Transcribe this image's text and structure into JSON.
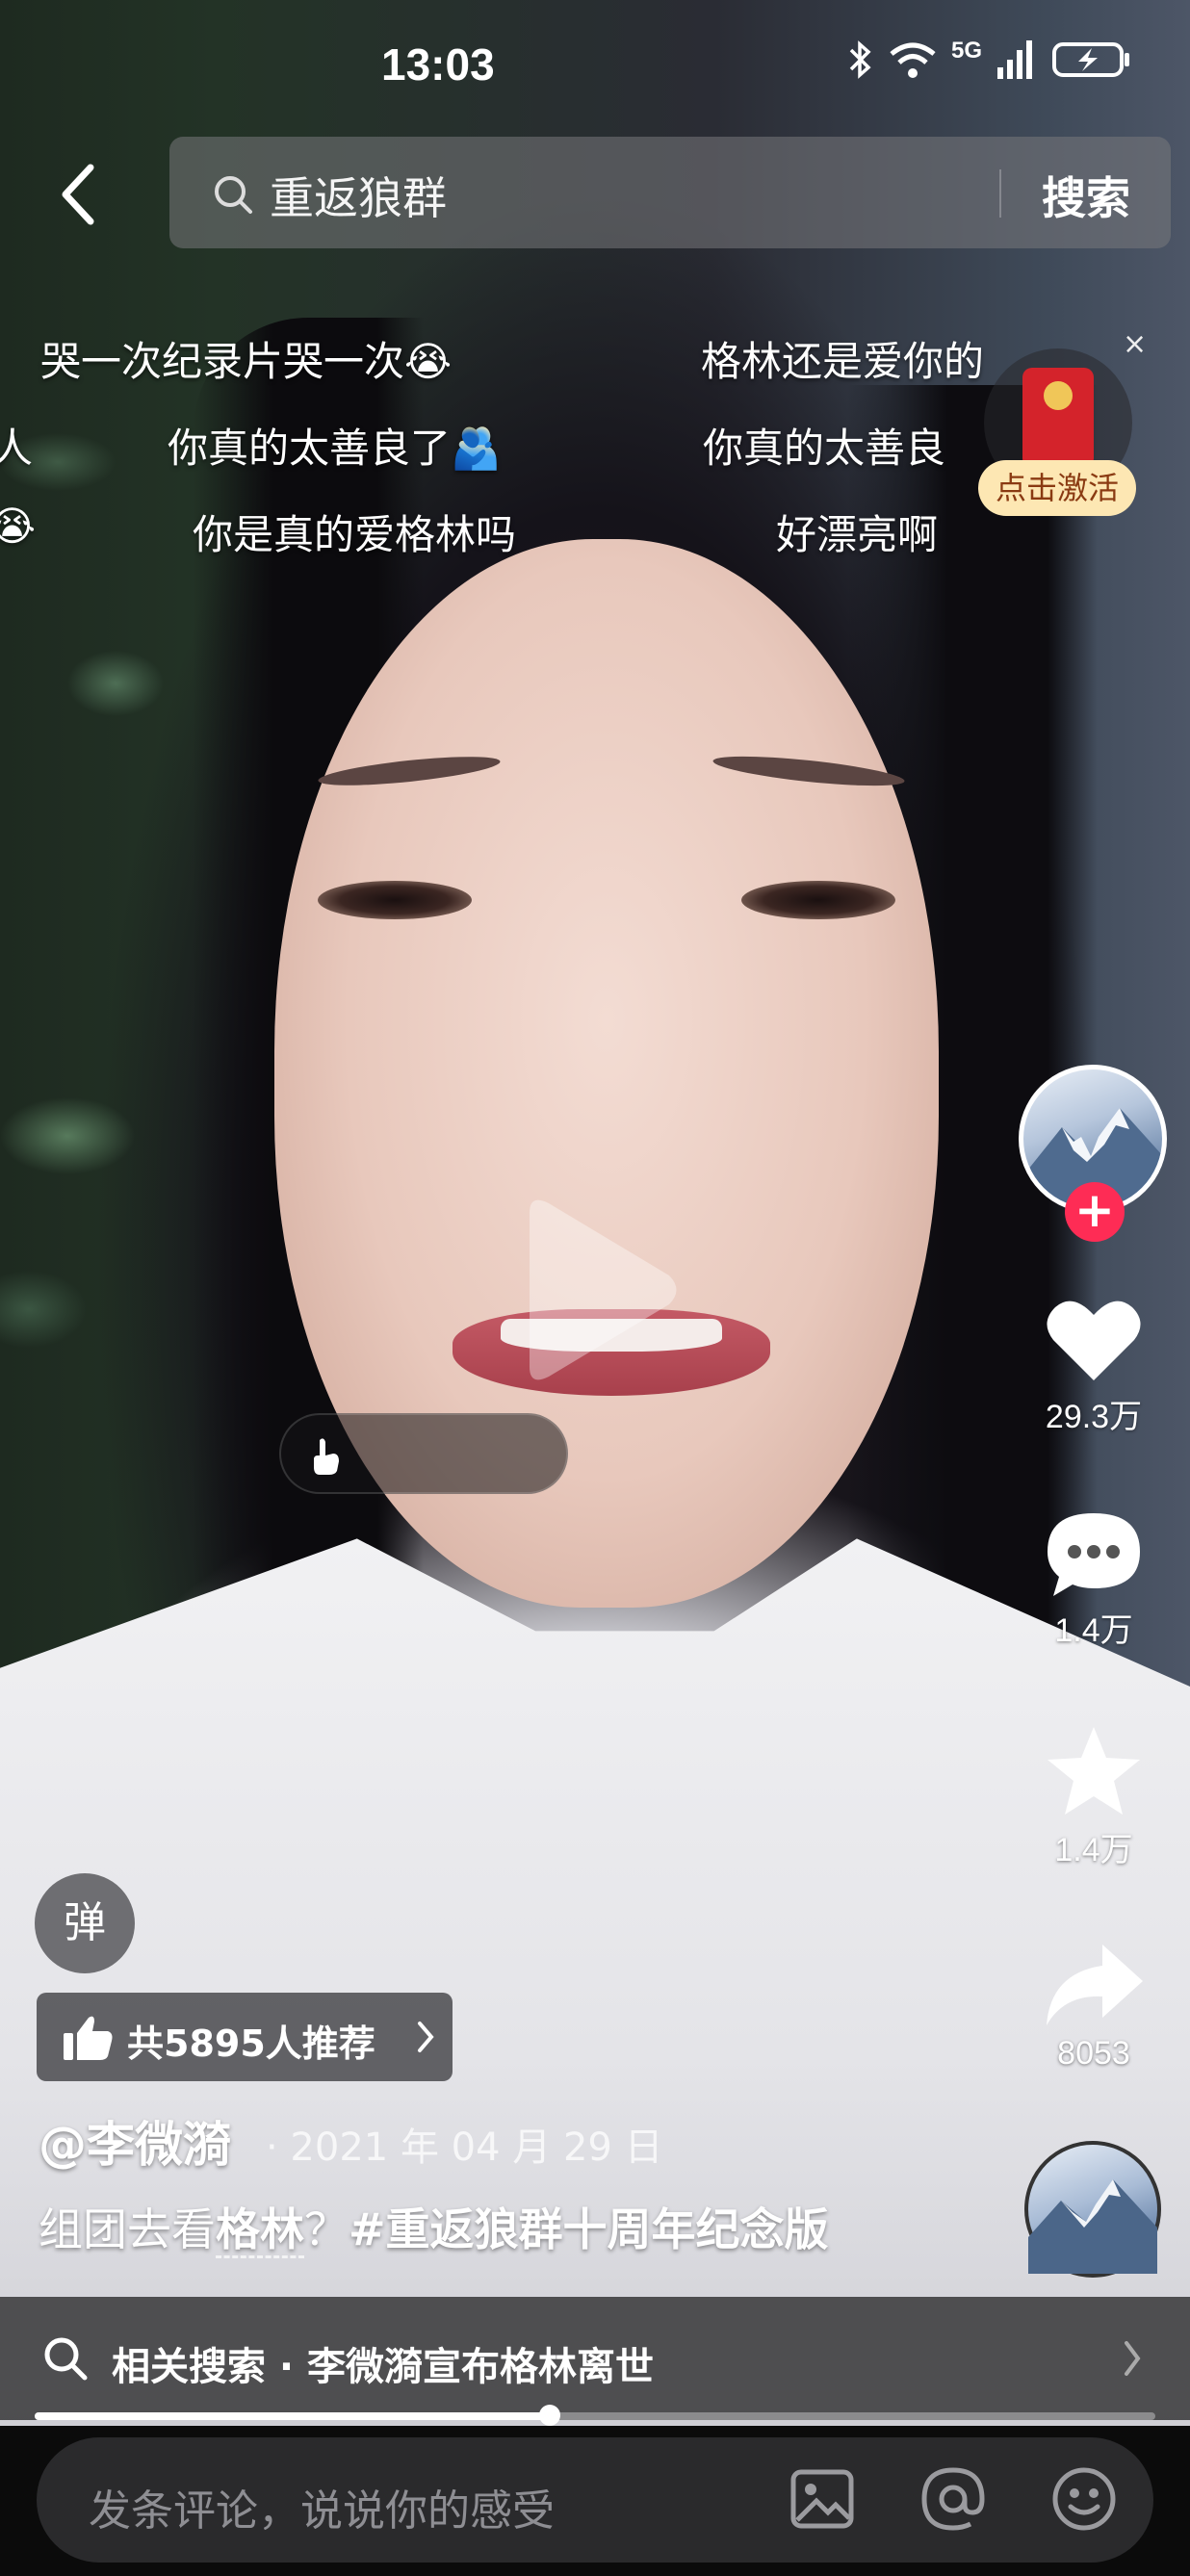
{
  "status_bar": {
    "time": "13:03",
    "network": "5G",
    "icons": [
      "bluetooth-icon",
      "wifi-icon",
      "signal-icon",
      "battery-charging-icon"
    ]
  },
  "search": {
    "query": "重返狼群",
    "button_label": "搜索"
  },
  "danmaku": [
    "哭一次纪录片哭一次😭",
    "格林还是爱你的",
    "人",
    "你真的太善良了🫂",
    "你真的太善良",
    "😭",
    "你是真的爱格林吗",
    "好漂亮啊"
  ],
  "red_packet": {
    "label": "点击激活",
    "close": "×"
  },
  "actions": {
    "like_count": "29.3万",
    "comment_count": "1.4万",
    "favorite_count": "1.4万",
    "share_count": "8053",
    "follow": "+"
  },
  "video_info": {
    "danmaku_toggle": "弹",
    "recommend_text": "共5895人推荐",
    "author": "@李微漪",
    "date": "· 2021 年 04 月 29 日",
    "caption_prefix": "组团去看",
    "caption_keyword": "格林",
    "caption_mid": "？",
    "caption_hashtag": "#重返狼群十周年纪念版"
  },
  "related_search": {
    "text": "相关搜索 · 李微漪宣布格林离世"
  },
  "progress": {
    "played_fraction": 0.46
  },
  "comment_bar": {
    "placeholder": "发条评论，说说你的感受"
  },
  "colors": {
    "accent": "#fe2c55",
    "red_packet": "#d4232b",
    "red_packet_label_bg": "#fde7b3"
  }
}
